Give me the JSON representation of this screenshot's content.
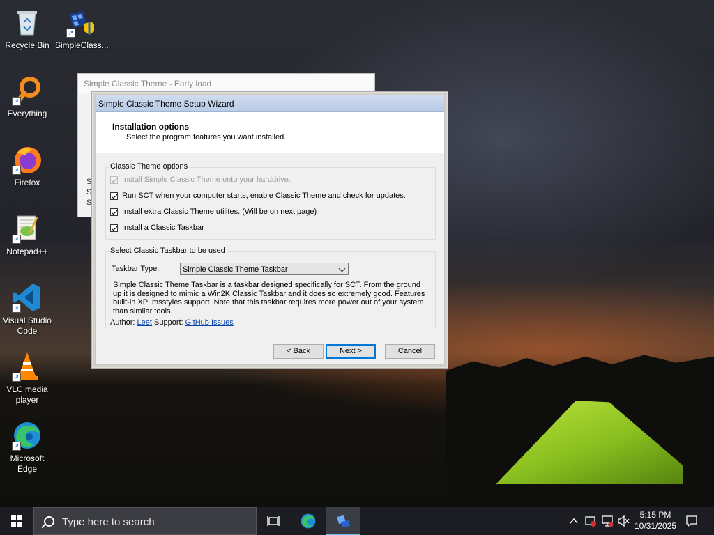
{
  "desktop": {
    "icons": [
      {
        "label": "Recycle Bin"
      },
      {
        "label": "SimpleClass..."
      },
      {
        "label": "Everything"
      },
      {
        "label": "Firefox"
      },
      {
        "label": "Notepad++"
      },
      {
        "label": "Visual Studio Code"
      },
      {
        "label": "VLC media player"
      },
      {
        "label": "Microsoft Edge"
      }
    ]
  },
  "background_window": {
    "title": "Simple Classic Theme - Early load",
    "letters": [
      "S",
      "S",
      "S"
    ],
    "dot": "·"
  },
  "wizard": {
    "title": "Simple Classic Theme Setup Wizard",
    "header_title": "Installation options",
    "header_subtitle": "Select the program features you want installed.",
    "options_group": {
      "legend": "Classic Theme options",
      "items": [
        {
          "label": "Install Simple Classic Theme onto your harddrive.",
          "checked": true,
          "disabled": true
        },
        {
          "label": "Run SCT when your computer starts, enable Classic Theme and check for updates.",
          "checked": true,
          "disabled": false
        },
        {
          "label": "Install extra Classic Theme utilites. (Will be on next page)",
          "checked": true,
          "disabled": false
        },
        {
          "label": "Install a Classic Taskbar",
          "checked": true,
          "disabled": false
        }
      ]
    },
    "taskbar_group": {
      "legend": "Select Classic Taskbar to be used",
      "type_label": "Taskbar Type:",
      "selected": "Simple Classic Theme Taskbar",
      "description": "Simple Classic Theme Taskbar is a taskbar designed specifically for SCT. From the ground up it is designed to mimic a Win2K Classic Taskbar and it does so extremely good. Features built-in XP .msstyles support. Note that this taskbar requires more power out of your system than similar tools.",
      "author_label": "Author:",
      "author_link": "Leet",
      "support_label": "Support:",
      "support_link": "GitHub Issues"
    },
    "buttons": {
      "back": "< Back",
      "next": "Next >",
      "cancel": "Cancel"
    }
  },
  "taskbar": {
    "search_placeholder": "Type here to search",
    "time": "5:15 PM",
    "date": "10/31/2025"
  }
}
